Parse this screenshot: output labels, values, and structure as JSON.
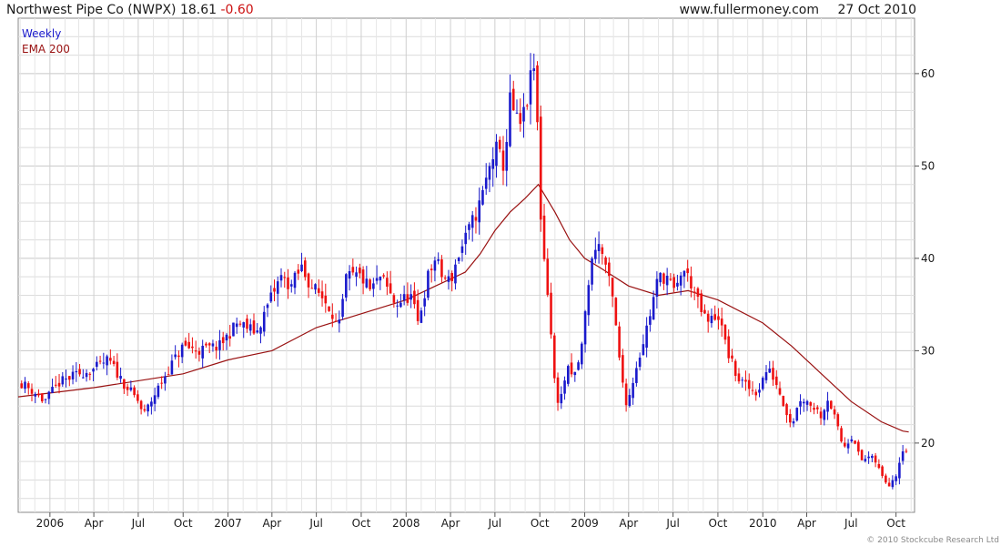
{
  "header": {
    "title": "Northwest Pipe Co (NWPX) 18.61",
    "change": "-0.60",
    "site": "www.fullermoney.com",
    "date": "27 Oct 2010"
  },
  "legend": {
    "weekly": "Weekly",
    "ema": "EMA 200"
  },
  "copyright": "© 2010 Stockcube Research Ltd",
  "colors": {
    "up": "#1a1acc",
    "down": "#ee1111",
    "ema": "#991111",
    "grid": "#dcdcdc"
  },
  "chart_data": {
    "type": "candlestick",
    "x_range": [
      "2005-10-28",
      "2010-11-08"
    ],
    "y_range": [
      12.5,
      66
    ],
    "y_ticks": [
      20,
      30,
      40,
      50,
      60
    ],
    "x_ticks": [
      {
        "label": "2006",
        "date": "2006-01-01"
      },
      {
        "label": "Apr",
        "date": "2006-04-01"
      },
      {
        "label": "Jul",
        "date": "2006-07-01"
      },
      {
        "label": "Oct",
        "date": "2006-10-01"
      },
      {
        "label": "2007",
        "date": "2007-01-01"
      },
      {
        "label": "Apr",
        "date": "2007-04-01"
      },
      {
        "label": "Jul",
        "date": "2007-07-01"
      },
      {
        "label": "Oct",
        "date": "2007-10-01"
      },
      {
        "label": "2008",
        "date": "2008-01-01"
      },
      {
        "label": "Apr",
        "date": "2008-04-01"
      },
      {
        "label": "Jul",
        "date": "2008-07-01"
      },
      {
        "label": "Oct",
        "date": "2008-10-01"
      },
      {
        "label": "2009",
        "date": "2009-01-01"
      },
      {
        "label": "Apr",
        "date": "2009-04-01"
      },
      {
        "label": "Jul",
        "date": "2009-07-01"
      },
      {
        "label": "Oct",
        "date": "2009-10-01"
      },
      {
        "label": "2010",
        "date": "2010-01-01"
      },
      {
        "label": "Apr",
        "date": "2010-04-01"
      },
      {
        "label": "Jul",
        "date": "2010-07-01"
      },
      {
        "label": "Oct",
        "date": "2010-10-01"
      }
    ],
    "close_anchors": [
      [
        "2005-11-04",
        26.5
      ],
      [
        "2005-12-01",
        25.5
      ],
      [
        "2005-12-20",
        24.5
      ],
      [
        "2006-01-20",
        26.5
      ],
      [
        "2006-03-01",
        27.5
      ],
      [
        "2006-04-01",
        28.0
      ],
      [
        "2006-05-01",
        29.0
      ],
      [
        "2006-06-01",
        26.5
      ],
      [
        "2006-07-01",
        24.5
      ],
      [
        "2006-07-12",
        23.0
      ],
      [
        "2006-08-01",
        25.0
      ],
      [
        "2006-09-01",
        28.0
      ],
      [
        "2006-10-01",
        30.5
      ],
      [
        "2006-11-01",
        30.0
      ],
      [
        "2006-12-15",
        30.5
      ],
      [
        "2007-01-20",
        33.0
      ],
      [
        "2007-03-01",
        32.0
      ],
      [
        "2007-04-01",
        36.0
      ],
      [
        "2007-04-20",
        38.0
      ],
      [
        "2007-05-10",
        37.0
      ],
      [
        "2007-06-01",
        39.0
      ],
      [
        "2007-06-20",
        37.0
      ],
      [
        "2007-07-10",
        36.0
      ],
      [
        "2007-08-01",
        34.5
      ],
      [
        "2007-08-15",
        32.0
      ],
      [
        "2007-09-01",
        38.0
      ],
      [
        "2007-10-01",
        38.0
      ],
      [
        "2007-10-20",
        36.5
      ],
      [
        "2007-11-10",
        38.0
      ],
      [
        "2007-12-10",
        35.0
      ],
      [
        "2008-01-10",
        36.0
      ],
      [
        "2008-01-25",
        33.0
      ],
      [
        "2008-02-15",
        38.0
      ],
      [
        "2008-03-01",
        40.0
      ],
      [
        "2008-03-15",
        38.0
      ],
      [
        "2008-04-01",
        37.5
      ],
      [
        "2008-04-15",
        40.0
      ],
      [
        "2008-05-01",
        42.0
      ],
      [
        "2008-06-01",
        46.0
      ],
      [
        "2008-07-01",
        52.0
      ],
      [
        "2008-07-20",
        50.0
      ],
      [
        "2008-08-01",
        57.0
      ],
      [
        "2008-08-20",
        54.0
      ],
      [
        "2008-09-01",
        56.0
      ],
      [
        "2008-09-15",
        60.0
      ],
      [
        "2008-09-22",
        61.0
      ],
      [
        "2008-10-01",
        46.0
      ],
      [
        "2008-10-10",
        40.0
      ],
      [
        "2008-10-20",
        35.0
      ],
      [
        "2008-10-30",
        27.0
      ],
      [
        "2008-11-10",
        24.0
      ],
      [
        "2008-11-25",
        28.0
      ],
      [
        "2008-12-10",
        27.0
      ],
      [
        "2008-12-25",
        30.0
      ],
      [
        "2009-01-10",
        38.0
      ],
      [
        "2009-01-25",
        42.0
      ],
      [
        "2009-02-10",
        40.0
      ],
      [
        "2009-03-01",
        35.0
      ],
      [
        "2009-03-15",
        28.0
      ],
      [
        "2009-03-29",
        24.0
      ],
      [
        "2009-04-15",
        28.0
      ],
      [
        "2009-05-01",
        31.0
      ],
      [
        "2009-05-15",
        34.0
      ],
      [
        "2009-06-01",
        38.0
      ],
      [
        "2009-06-20",
        38.0
      ],
      [
        "2009-07-05",
        36.0
      ],
      [
        "2009-07-20",
        39.0
      ],
      [
        "2009-08-10",
        37.0
      ],
      [
        "2009-08-25",
        34.5
      ],
      [
        "2009-09-10",
        33.0
      ],
      [
        "2009-10-01",
        34.0
      ],
      [
        "2009-10-20",
        30.0
      ],
      [
        "2009-11-10",
        27.0
      ],
      [
        "2009-12-01",
        26.0
      ],
      [
        "2009-12-20",
        25.5
      ],
      [
        "2010-01-10",
        28.0
      ],
      [
        "2010-01-25",
        27.0
      ],
      [
        "2010-02-15",
        24.0
      ],
      [
        "2010-03-01",
        22.0
      ],
      [
        "2010-03-20",
        25.0
      ],
      [
        "2010-04-15",
        24.0
      ],
      [
        "2010-05-01",
        23.0
      ],
      [
        "2010-05-15",
        25.0
      ],
      [
        "2010-06-01",
        22.0
      ],
      [
        "2010-06-15",
        19.5
      ],
      [
        "2010-07-05",
        21.0
      ],
      [
        "2010-07-20",
        18.0
      ],
      [
        "2010-08-05",
        18.5
      ],
      [
        "2010-08-20",
        18.0
      ],
      [
        "2010-09-01",
        16.5
      ],
      [
        "2010-09-15",
        15.5
      ],
      [
        "2010-09-30",
        16.5
      ],
      [
        "2010-10-15",
        19.5
      ],
      [
        "2010-10-22",
        19.2
      ],
      [
        "2010-10-27",
        18.61
      ]
    ],
    "ema_anchors": [
      [
        "2005-10-28",
        25.0
      ],
      [
        "2006-04-01",
        26.0
      ],
      [
        "2006-10-01",
        27.5
      ],
      [
        "2007-01-01",
        29.0
      ],
      [
        "2007-04-01",
        30.0
      ],
      [
        "2007-07-01",
        32.5
      ],
      [
        "2007-10-01",
        34.0
      ],
      [
        "2008-01-01",
        35.5
      ],
      [
        "2008-03-01",
        37.0
      ],
      [
        "2008-05-01",
        38.5
      ],
      [
        "2008-06-01",
        40.5
      ],
      [
        "2008-07-01",
        43.0
      ],
      [
        "2008-08-01",
        45.0
      ],
      [
        "2008-09-01",
        46.5
      ],
      [
        "2008-09-28",
        48.0
      ],
      [
        "2008-11-01",
        45.0
      ],
      [
        "2008-12-01",
        42.0
      ],
      [
        "2009-01-01",
        40.0
      ],
      [
        "2009-02-01",
        39.0
      ],
      [
        "2009-04-01",
        37.0
      ],
      [
        "2009-06-01",
        36.0
      ],
      [
        "2009-08-01",
        36.5
      ],
      [
        "2009-10-01",
        35.5
      ],
      [
        "2010-01-01",
        33.0
      ],
      [
        "2010-03-01",
        30.5
      ],
      [
        "2010-05-01",
        27.5
      ],
      [
        "2010-07-01",
        24.5
      ],
      [
        "2010-09-01",
        22.3
      ],
      [
        "2010-10-15",
        21.3
      ],
      [
        "2010-10-27",
        21.2
      ]
    ]
  }
}
